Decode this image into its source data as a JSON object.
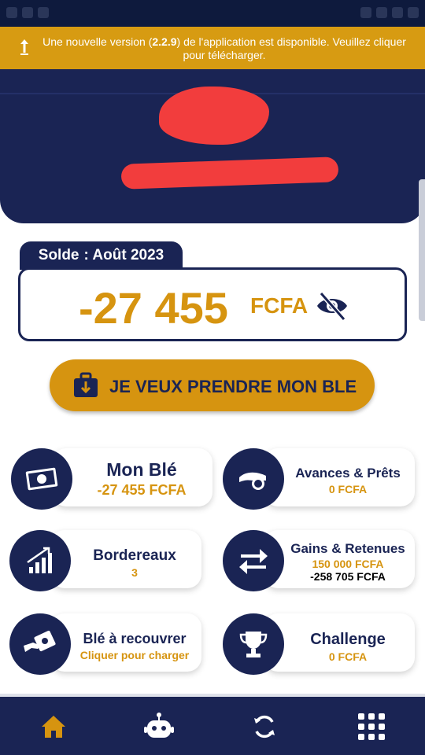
{
  "update_banner": {
    "prefix": "Une nouvelle version (",
    "version": "2.2.9",
    "suffix": ") de l'application est disponible. Veuillez cliquer pour télécharger."
  },
  "balance": {
    "tab_label": "Solde",
    "tab_period": ": Août 2023",
    "amount": "-27 455",
    "currency": "FCFA"
  },
  "cta": {
    "label": "JE VEUX PRENDRE MON BLE"
  },
  "cards": [
    {
      "title": "Mon Blé",
      "value": "-27 455 FCFA",
      "icon": "banknote-icon"
    },
    {
      "title": "Avances & Prêts",
      "value": "0 FCFA",
      "icon": "hand-coin-icon"
    },
    {
      "title": "Bordereaux",
      "value": "3",
      "icon": "bar-chart-up-icon"
    },
    {
      "title": "Gains & Retenues",
      "value": "150 000 FCFA",
      "value2": "-258 705 FCFA",
      "icon": "swap-arrows-icon"
    },
    {
      "title": "Blé à recouvrer",
      "value": "Cliquer pour charger",
      "icon": "hand-money-icon"
    },
    {
      "title": "Challenge",
      "value": "0 FCFA",
      "icon": "trophy-icon"
    }
  ],
  "bottom_nav": [
    {
      "name": "home",
      "icon": "home-icon",
      "active": true
    },
    {
      "name": "bot",
      "icon": "robot-icon",
      "active": false
    },
    {
      "name": "sync",
      "icon": "sync-icon",
      "active": false
    },
    {
      "name": "menu",
      "icon": "grid-icon",
      "active": false
    }
  ],
  "colors": {
    "navy": "#1a2454",
    "gold": "#d69410",
    "banner": "#d79b12",
    "redaction": "#f23d3d"
  }
}
